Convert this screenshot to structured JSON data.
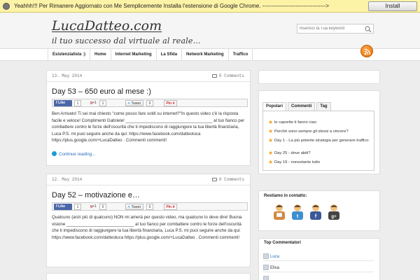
{
  "notification": {
    "icon": "puzzle-icon",
    "message": "Yeahhh!!! Per Rimanere Aggiornato con Me Semplicemente Installa l'estensione di Google Chrome. ---------------------------------->",
    "install_label": "Install"
  },
  "header": {
    "logo": "LucaDatteo.com",
    "tagline": "il tuo successo dal virtuale al reale...",
    "search_placeholder": "Inserisci la Tua keyword"
  },
  "nav": {
    "items": [
      "Esistenzialista :)",
      "Home",
      "Internet Marketing",
      "La Sfida",
      "Network Marketing",
      "Traffico"
    ]
  },
  "posts": [
    {
      "date": "13. May 2014",
      "comments": "0 Comments",
      "title": "Day 53 – 650 euro al mese :)",
      "share": {
        "fb_label": "Like",
        "fb_count": "1",
        "gplus_label": "+1",
        "gplus_count": "1",
        "tweet_label": "Tweet",
        "tweet_count": "0",
        "pin_label": "Pin it"
      },
      "body": "Ben Arrivato! Ti sei mai chiesto \"come posso fare soldi su internet?\"In questo video c'è la risposta facile e veloce! Complimenti Gabriele! ____________________________________ al tuo fianco per combattere contro le forze dell'oscurità che ti impediscono di raggiungere la tua libertà finanziaria, Luca P.S. mi puoi seguire anche da qui: https://www.facebook.com/datteoluca https://plus.google.com/+LucaDatteo . Commenti commenti!",
      "continue": "Continue reading..."
    },
    {
      "date": "12. May 2014",
      "comments": "0 Comments",
      "title": "Day 52 – motivazione e…",
      "share": {
        "fb_label": "Like",
        "fb_count": "1",
        "gplus_label": "+1",
        "gplus_count": "0",
        "tweet_label": "Tweet",
        "tweet_count": "0",
        "pin_label": "Pin it"
      },
      "body": "Qualcuno (anzi più di qualcuno) NON mi amerà per questo video, ma qualcuno lo deve dire! Buona visione ____________________________ al tuo fianco per combattere contro le forze dell'oscurità che ti impediscono di raggiungere la tua libertà finanziaria, Luca P.S. mi puoi seguire anche da qui: https://www.facebook.com/datteoluca https://plus.google.com/+LucaDatteo . Commenti commenti!",
      "continue": "Continue reading..."
    }
  ],
  "sidebar": {
    "tabs": [
      "Popolari",
      "Commenti",
      "Tag"
    ],
    "popular": [
      "le caprette ti fanno ciao",
      "Perchè sono sempre gli stessi a vincere?",
      "Day 1 - La più potente strategia per generare traffico",
      "Day 25 - dove abiti?",
      "Day 19 - nonostante tutto"
    ],
    "contact_title": "Restiamo in contatto:",
    "social_icons": [
      "email-icon",
      "twitter-icon",
      "facebook-icon",
      "google-plus-icon"
    ],
    "commenters_title": "Top Commentatori",
    "commenters": [
      "Luca",
      "Elisa",
      ""
    ]
  },
  "colors": {
    "link": "#2a6ebb",
    "notification_bg": "#fdf3a7",
    "rss": "#e36f06",
    "facebook": "#4a67a8",
    "star": "#f2a11a"
  }
}
